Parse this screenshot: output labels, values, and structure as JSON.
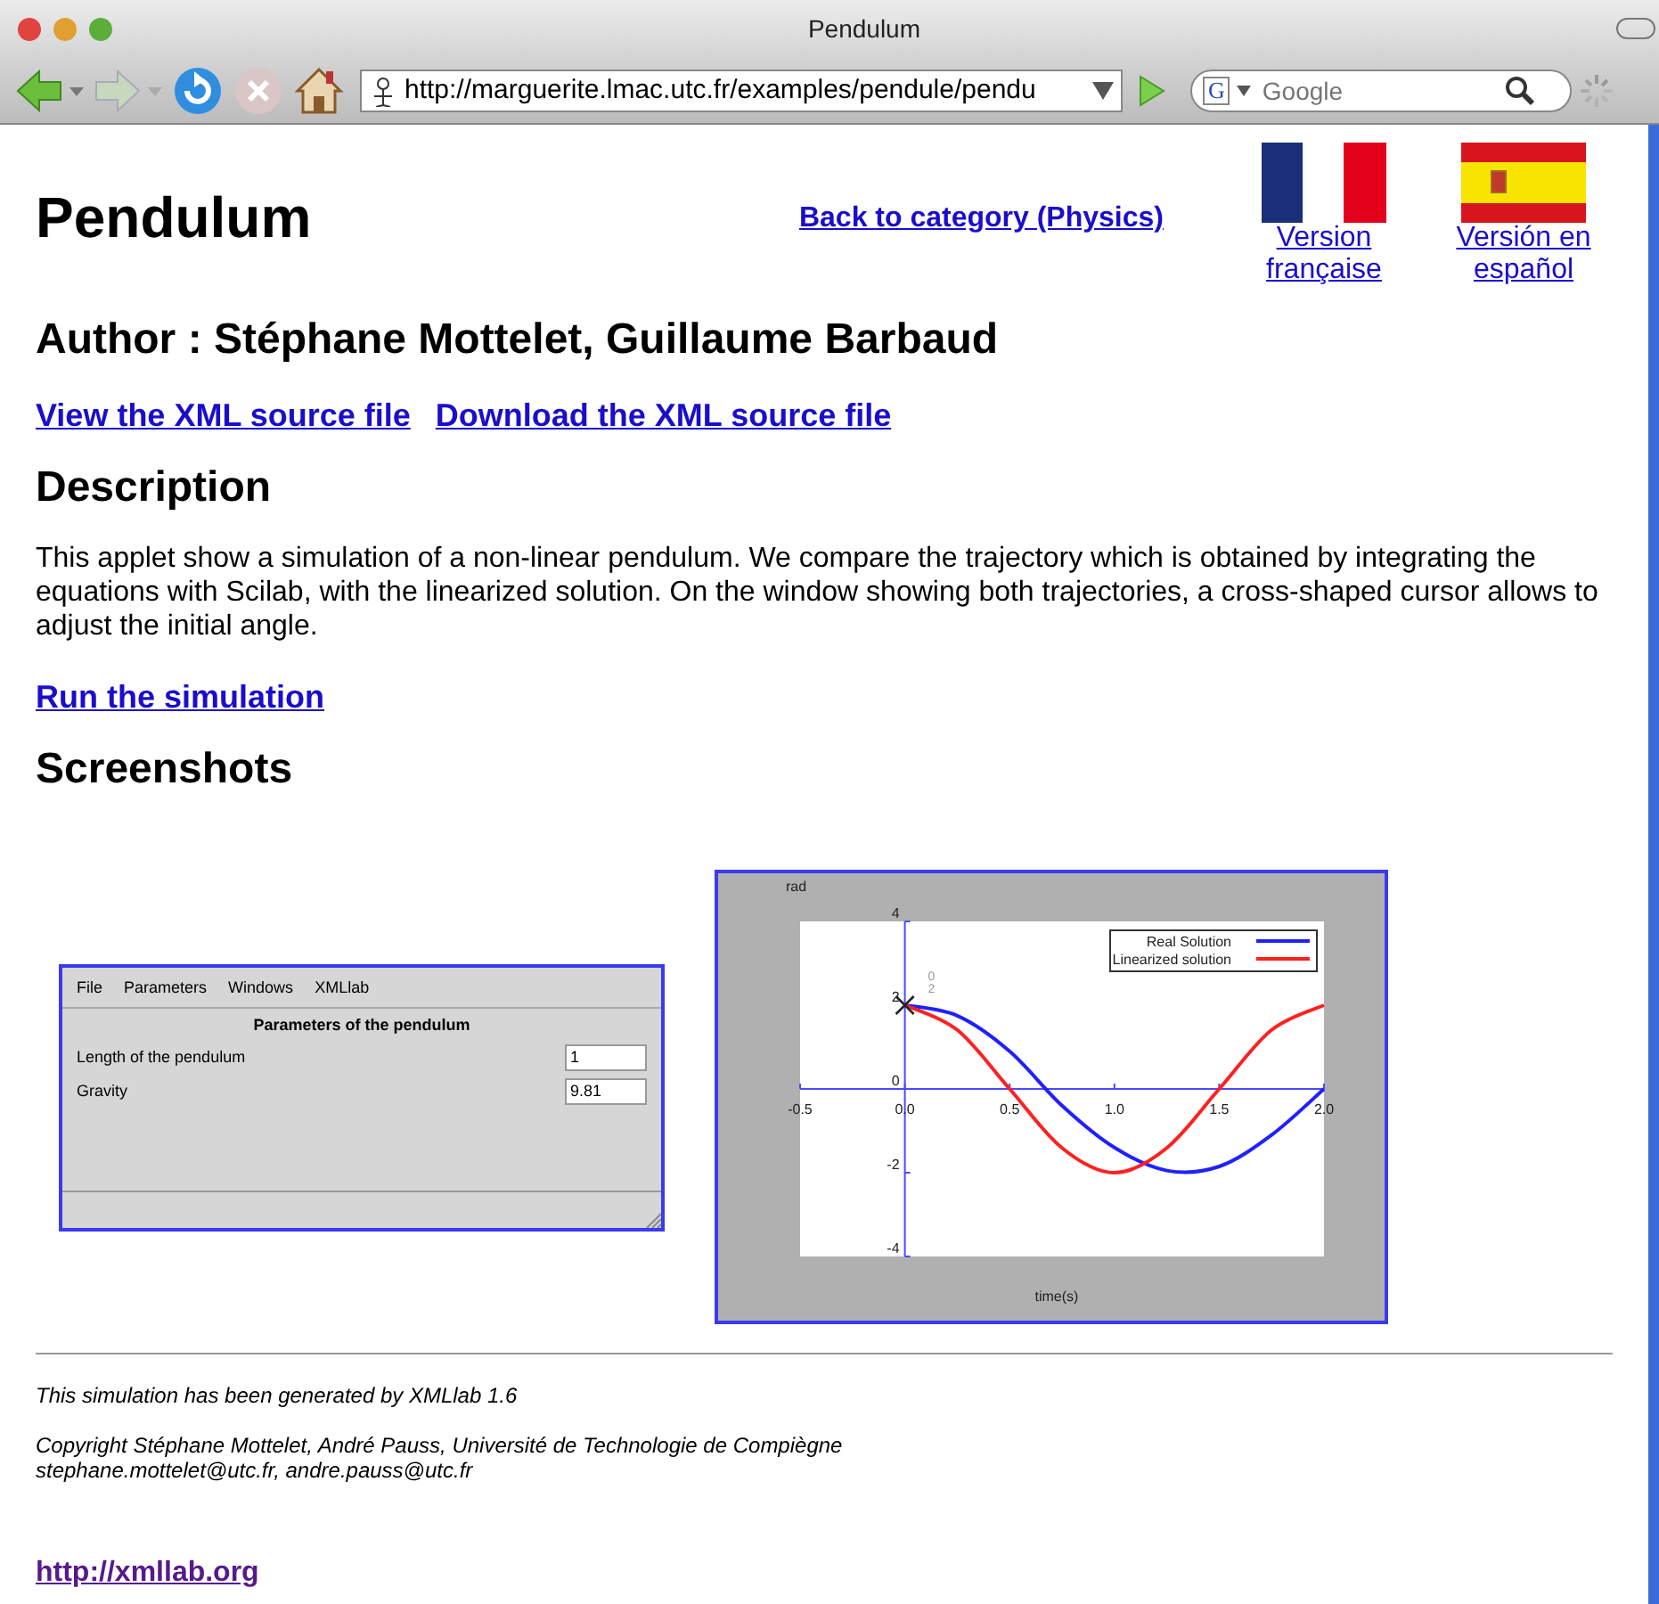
{
  "window": {
    "title": "Pendulum"
  },
  "toolbar": {
    "url": "http://marguerite.lmac.utc.fr/examples/pendule/pendu",
    "search_engine_logo": "G",
    "search": {
      "placeholder": "Google"
    },
    "forward_disabled": true,
    "stop_disabled": true
  },
  "page": {
    "title": "Pendulum",
    "back_link": "Back to category (Physics)",
    "languages": [
      {
        "kind": "fr",
        "label": "Version française"
      },
      {
        "kind": "es",
        "label": "Versión en español"
      }
    ],
    "author": "Author : Stéphane Mottelet, Guillaume Barbaud",
    "source_links": [
      "View the XML source file",
      "Download the XML source file"
    ],
    "description_heading": "Description",
    "description": "This applet show a simulation of a non-linear pendulum. We compare the trajectory which is obtained by integrating the equations with Scilab, with the linearized solution. On the window showing both trajectories, a cross-shaped cursor allows to adjust the initial angle.",
    "run_link": "Run the simulation",
    "screenshots_heading": "Screenshots",
    "parameters_window": {
      "menu": [
        "File",
        "Parameters",
        "Windows",
        "XMLlab"
      ],
      "title": "Parameters of the pendulum",
      "fields": [
        {
          "label": "Length of the pendulum",
          "value": "1"
        },
        {
          "label": "Gravity",
          "value": "9.81"
        }
      ]
    },
    "plot_window": {
      "cursor_readout": [
        "0",
        "2"
      ],
      "chart_data": {
        "type": "line",
        "xlabel": "time(s)",
        "ylabel": "rad",
        "x": [
          0,
          0.25,
          0.5,
          0.75,
          1.0,
          1.25,
          1.5,
          1.75,
          2.0
        ],
        "series": [
          {
            "name": "Real Solution",
            "color": "#2020ff",
            "values": [
              2,
              1.75,
              0.9,
              -0.4,
              -1.4,
              -1.95,
              -1.85,
              -1.1,
              0
            ]
          },
          {
            "name": "Linearized solution",
            "color": "#ff2020",
            "values": [
              2,
              1.41,
              0,
              -1.41,
              -2,
              -1.41,
              0,
              1.41,
              2
            ]
          }
        ],
        "legend": "upper right",
        "xlim": [
          -0.5,
          2.0
        ],
        "ylim": [
          -4,
          4
        ],
        "xticks": [
          {
            "value": -0.5,
            "label": "-0.5"
          },
          {
            "value": 0,
            "label": "0.0"
          },
          {
            "value": 0.5,
            "label": "0.5"
          },
          {
            "value": 1,
            "label": "1.0"
          },
          {
            "value": 1.5,
            "label": "1.5"
          },
          {
            "value": 2,
            "label": "2.0"
          }
        ],
        "yticks": [
          {
            "value": 4,
            "label": "4"
          },
          {
            "value": 2,
            "label": "2"
          },
          {
            "value": 0,
            "label": "0"
          },
          {
            "value": -2,
            "label": "-2"
          },
          {
            "value": -4,
            "label": "-4"
          }
        ]
      }
    }
  },
  "footer": {
    "generated": "This simulation has been generated by XMLlab 1.6",
    "copyright": "Copyright Stéphane Mottelet, André Pauss, Université de Technologie de Compiègne",
    "emails": "stephane.mottelet@utc.fr, andre.pauss@utc.fr",
    "site_link": "http://xmllab.org"
  }
}
